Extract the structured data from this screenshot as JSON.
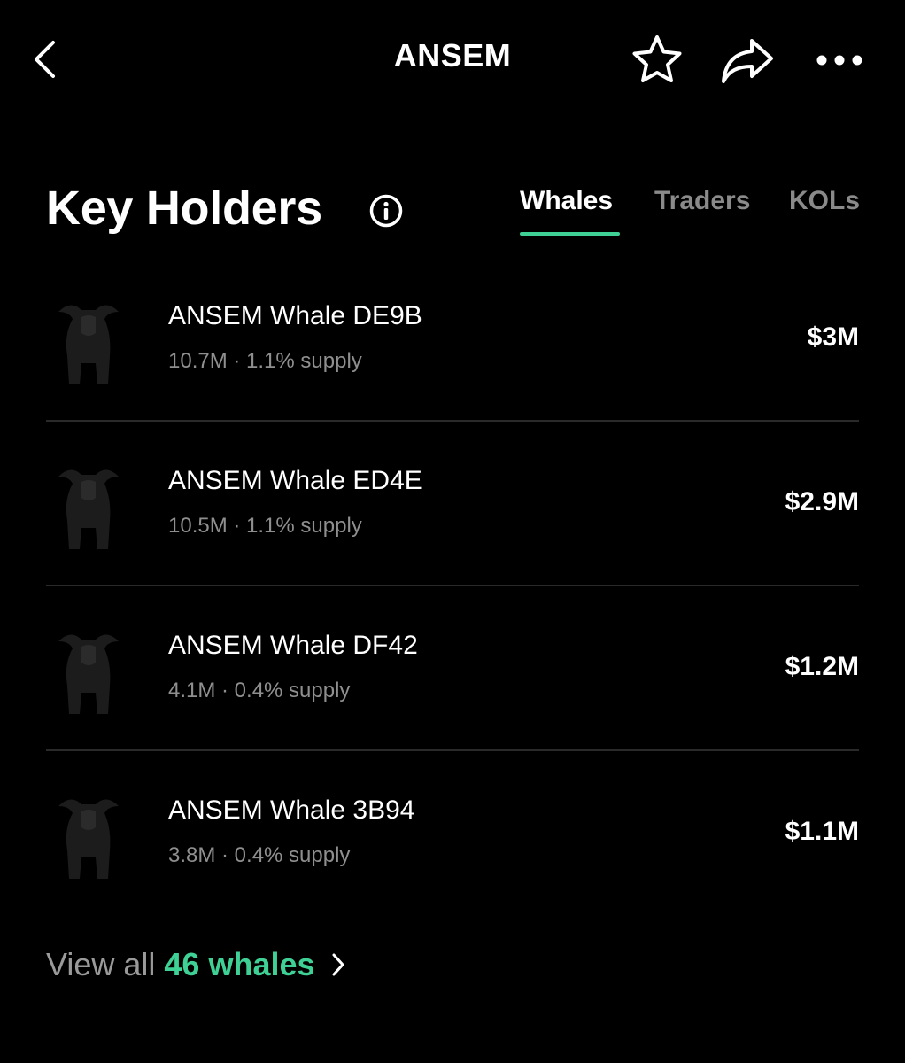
{
  "header": {
    "title": "ANSEM",
    "back_icon": "chevron-left-icon",
    "actions": [
      "star-icon",
      "share-icon",
      "more-icon"
    ]
  },
  "key_holders": {
    "title": "Key Holders",
    "info_icon": "info-icon",
    "tabs": [
      {
        "label": "Whales",
        "active": true
      },
      {
        "label": "Traders",
        "active": false
      },
      {
        "label": "KOLs",
        "active": false
      }
    ],
    "accent_color": "#3fd095",
    "holders": [
      {
        "name": "ANSEM Whale DE9B",
        "subtitle": "10.7M · 1.1% supply",
        "value": "$3M",
        "avatar": "bull-avatar"
      },
      {
        "name": "ANSEM Whale ED4E",
        "subtitle": "10.5M · 1.1% supply",
        "value": "$2.9M",
        "avatar": "bull-avatar"
      },
      {
        "name": "ANSEM Whale DF42",
        "subtitle": "4.1M · 0.4% supply",
        "value": "$1.2M",
        "avatar": "bull-avatar"
      },
      {
        "name": "ANSEM Whale 3B94",
        "subtitle": "3.8M · 0.4% supply",
        "value": "$1.1M",
        "avatar": "bull-avatar"
      }
    ],
    "view_all": {
      "prefix": "View all",
      "link": "46 whales",
      "icon": "chevron-right-icon"
    }
  }
}
